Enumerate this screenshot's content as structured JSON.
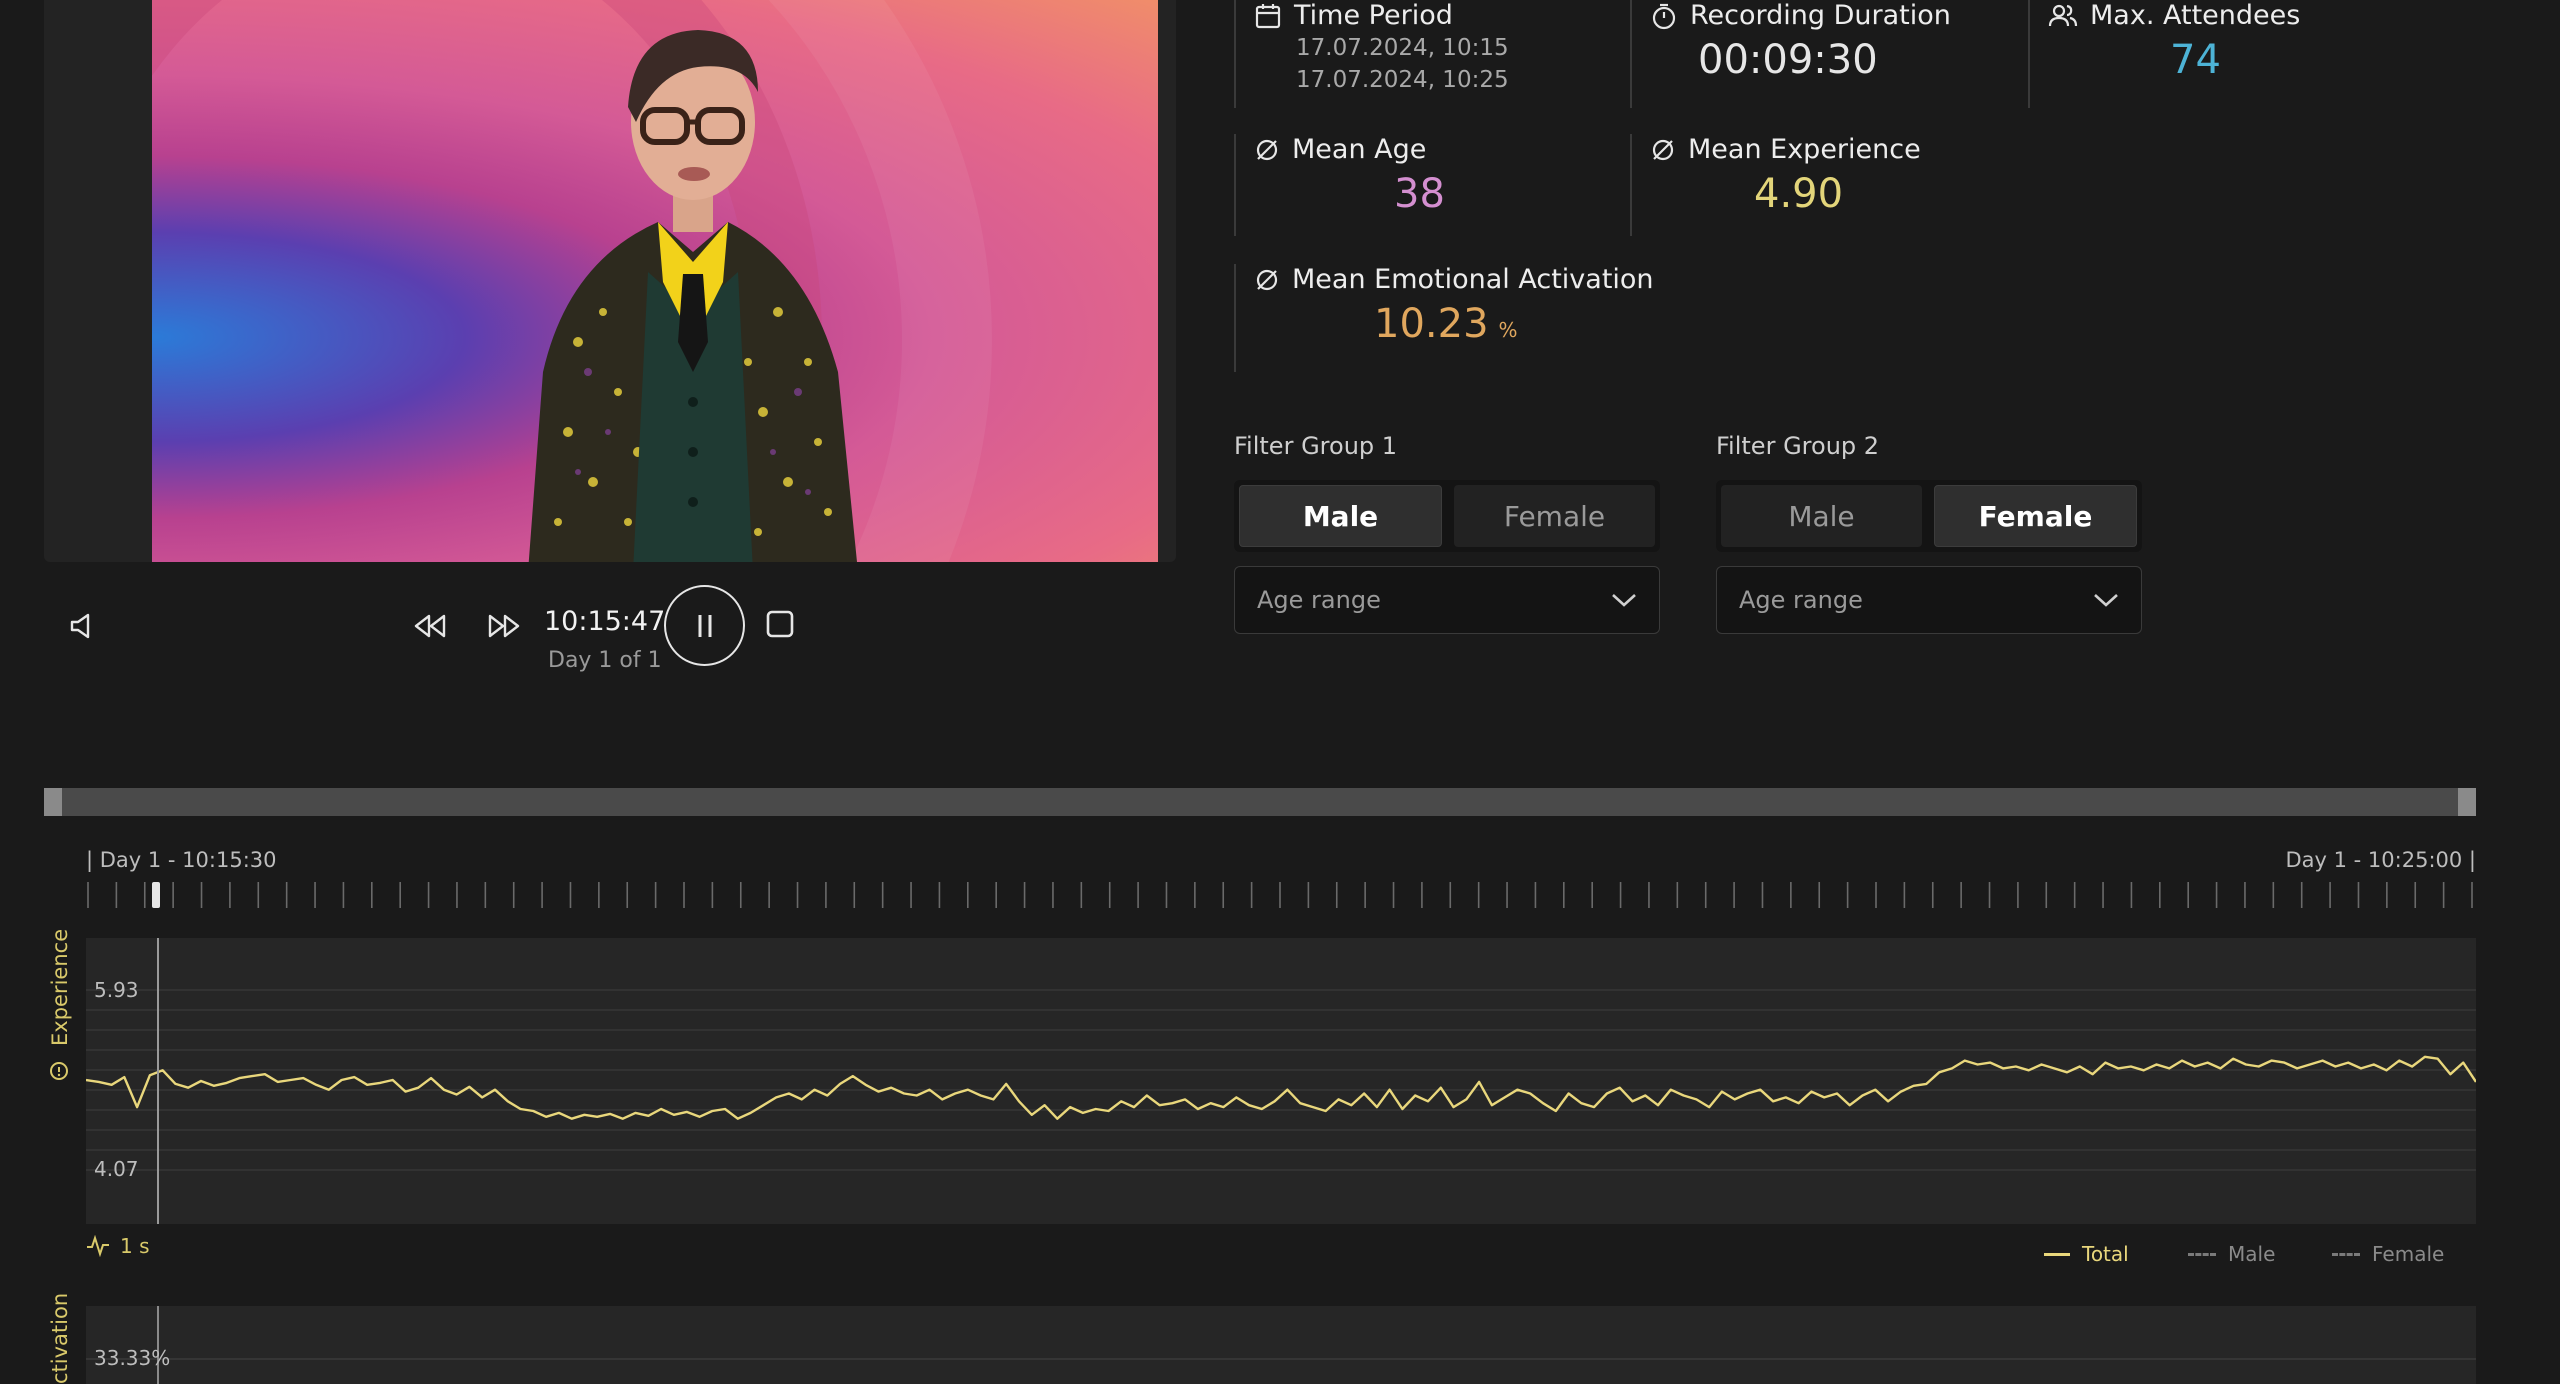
{
  "player": {
    "timecode": "10:15:47",
    "day_label": "Day 1 of 1"
  },
  "stats": {
    "time_period": {
      "label": "Time Period",
      "start": "17.07.2024, 10:15",
      "end": "17.07.2024, 10:25"
    },
    "recording_duration": {
      "label": "Recording Duration",
      "value": "00:09:30"
    },
    "max_attendees": {
      "label": "Max. Attendees",
      "value": "74",
      "color": "#4db3d6"
    },
    "mean_age": {
      "label": "Mean Age",
      "value": "38",
      "color": "#d48fd0"
    },
    "mean_experience": {
      "label": "Mean Experience",
      "value": "4.90",
      "color": "#e3d57a"
    },
    "mean_activation": {
      "label": "Mean Emotional Activation",
      "value": "10.23",
      "unit": "%",
      "color": "#e0a75e"
    }
  },
  "filters": {
    "group1": {
      "label": "Filter Group 1",
      "options": [
        "Male",
        "Female"
      ],
      "selected": "Male",
      "age_placeholder": "Age range"
    },
    "group2": {
      "label": "Filter Group 2",
      "options": [
        "Male",
        "Female"
      ],
      "selected": "Female",
      "age_placeholder": "Age range"
    }
  },
  "timeline": {
    "start_label": "| Day 1 - 10:15:30",
    "end_label": "Day 1 - 10:25:00 |"
  },
  "experience_chart": {
    "axis_title": "Experience",
    "y_max_label": "5.93",
    "y_min_label": "4.07",
    "resolution": "1 s",
    "legend": {
      "total": "Total",
      "male": "Male",
      "female": "Female"
    },
    "line_color": "#e9d77c"
  },
  "activation_chart": {
    "axis_title": "ctivation",
    "y_max_label": "33.33",
    "y_max_unit": "%"
  },
  "chart_data": {
    "type": "line",
    "title": "",
    "xlabel": "",
    "ylabel": "Experience",
    "ylim": [
      4.07,
      5.93
    ],
    "x_range": [
      "10:15:30",
      "10:25:00"
    ],
    "series": [
      {
        "name": "Total",
        "values": [
          5.0,
          4.98,
          4.95,
          5.03,
          4.72,
          5.05,
          5.1,
          4.96,
          4.92,
          4.99,
          4.94,
          4.97,
          5.02,
          5.04,
          5.06,
          4.98,
          5.0,
          5.02,
          4.95,
          4.9,
          5.0,
          5.03,
          4.95,
          4.97,
          5.0,
          4.88,
          4.92,
          5.02,
          4.9,
          4.85,
          4.93,
          4.82,
          4.9,
          4.78,
          4.7,
          4.68,
          4.62,
          4.66,
          4.6,
          4.64,
          4.62,
          4.65,
          4.6,
          4.66,
          4.63,
          4.7,
          4.64,
          4.67,
          4.62,
          4.68,
          4.7,
          4.6,
          4.66,
          4.74,
          4.82,
          4.86,
          4.8,
          4.9,
          4.84,
          4.96,
          5.04,
          4.95,
          4.88,
          4.92,
          4.86,
          4.84,
          4.9,
          4.8,
          4.86,
          4.9,
          4.84,
          4.8,
          4.96,
          4.78,
          4.64,
          4.74,
          4.6,
          4.72,
          4.66,
          4.7,
          4.68,
          4.78,
          4.72,
          4.84,
          4.74,
          4.76,
          4.8,
          4.7,
          4.76,
          4.72,
          4.82,
          4.74,
          4.7,
          4.78,
          4.9,
          4.76,
          4.72,
          4.68,
          4.8,
          4.74,
          4.86,
          4.72,
          4.9,
          4.7,
          4.84,
          4.78,
          4.92,
          4.72,
          4.8,
          4.98,
          4.74,
          4.82,
          4.9,
          4.86,
          4.76,
          4.68,
          4.86,
          4.76,
          4.72,
          4.86,
          4.92,
          4.78,
          4.84,
          4.74,
          4.9,
          4.84,
          4.8,
          4.72,
          4.88,
          4.8,
          4.86,
          4.9,
          4.78,
          4.82,
          4.76,
          4.88,
          4.82,
          4.86,
          4.74,
          4.84,
          4.9,
          4.78,
          4.88,
          4.94,
          4.96,
          5.08,
          5.12,
          5.2,
          5.16,
          5.18,
          5.12,
          5.14,
          5.1,
          5.16,
          5.12,
          5.08,
          5.14,
          5.06,
          5.18,
          5.12,
          5.14,
          5.1,
          5.16,
          5.12,
          5.2,
          5.14,
          5.18,
          5.12,
          5.22,
          5.16,
          5.14,
          5.2,
          5.18,
          5.12,
          5.16,
          5.2,
          5.14,
          5.18,
          5.12,
          5.16,
          5.1,
          5.2,
          5.14,
          5.24,
          5.22,
          5.06,
          5.18,
          4.98
        ]
      }
    ]
  }
}
